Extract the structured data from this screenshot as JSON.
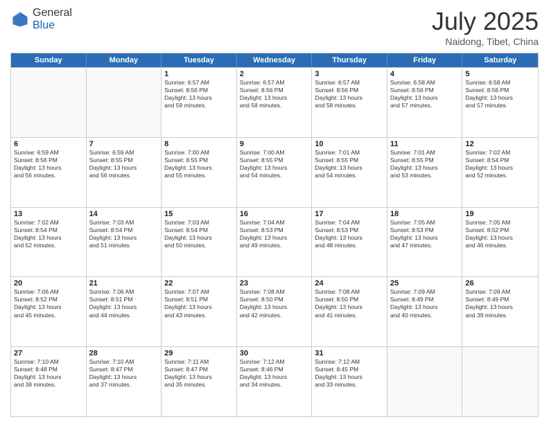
{
  "header": {
    "logo_general": "General",
    "logo_blue": "Blue",
    "month_title": "July 2025",
    "location": "Naidong, Tibet, China"
  },
  "weekdays": [
    "Sunday",
    "Monday",
    "Tuesday",
    "Wednesday",
    "Thursday",
    "Friday",
    "Saturday"
  ],
  "rows": [
    [
      {
        "day": "",
        "info": ""
      },
      {
        "day": "",
        "info": ""
      },
      {
        "day": "1",
        "info": "Sunrise: 6:57 AM\nSunset: 8:56 PM\nDaylight: 13 hours\nand 59 minutes."
      },
      {
        "day": "2",
        "info": "Sunrise: 6:57 AM\nSunset: 8:56 PM\nDaylight: 13 hours\nand 58 minutes."
      },
      {
        "day": "3",
        "info": "Sunrise: 6:57 AM\nSunset: 8:56 PM\nDaylight: 13 hours\nand 58 minutes."
      },
      {
        "day": "4",
        "info": "Sunrise: 6:58 AM\nSunset: 8:56 PM\nDaylight: 13 hours\nand 57 minutes."
      },
      {
        "day": "5",
        "info": "Sunrise: 6:58 AM\nSunset: 8:56 PM\nDaylight: 13 hours\nand 57 minutes."
      }
    ],
    [
      {
        "day": "6",
        "info": "Sunrise: 6:59 AM\nSunset: 8:56 PM\nDaylight: 13 hours\nand 56 minutes."
      },
      {
        "day": "7",
        "info": "Sunrise: 6:59 AM\nSunset: 8:55 PM\nDaylight: 13 hours\nand 56 minutes."
      },
      {
        "day": "8",
        "info": "Sunrise: 7:00 AM\nSunset: 8:55 PM\nDaylight: 13 hours\nand 55 minutes."
      },
      {
        "day": "9",
        "info": "Sunrise: 7:00 AM\nSunset: 8:55 PM\nDaylight: 13 hours\nand 54 minutes."
      },
      {
        "day": "10",
        "info": "Sunrise: 7:01 AM\nSunset: 8:55 PM\nDaylight: 13 hours\nand 54 minutes."
      },
      {
        "day": "11",
        "info": "Sunrise: 7:01 AM\nSunset: 8:55 PM\nDaylight: 13 hours\nand 53 minutes."
      },
      {
        "day": "12",
        "info": "Sunrise: 7:02 AM\nSunset: 8:54 PM\nDaylight: 13 hours\nand 52 minutes."
      }
    ],
    [
      {
        "day": "13",
        "info": "Sunrise: 7:02 AM\nSunset: 8:54 PM\nDaylight: 13 hours\nand 52 minutes."
      },
      {
        "day": "14",
        "info": "Sunrise: 7:03 AM\nSunset: 8:54 PM\nDaylight: 13 hours\nand 51 minutes."
      },
      {
        "day": "15",
        "info": "Sunrise: 7:03 AM\nSunset: 8:54 PM\nDaylight: 13 hours\nand 50 minutes."
      },
      {
        "day": "16",
        "info": "Sunrise: 7:04 AM\nSunset: 8:53 PM\nDaylight: 13 hours\nand 49 minutes."
      },
      {
        "day": "17",
        "info": "Sunrise: 7:04 AM\nSunset: 8:53 PM\nDaylight: 13 hours\nand 48 minutes."
      },
      {
        "day": "18",
        "info": "Sunrise: 7:05 AM\nSunset: 8:53 PM\nDaylight: 13 hours\nand 47 minutes."
      },
      {
        "day": "19",
        "info": "Sunrise: 7:05 AM\nSunset: 8:52 PM\nDaylight: 13 hours\nand 46 minutes."
      }
    ],
    [
      {
        "day": "20",
        "info": "Sunrise: 7:06 AM\nSunset: 8:52 PM\nDaylight: 13 hours\nand 45 minutes."
      },
      {
        "day": "21",
        "info": "Sunrise: 7:06 AM\nSunset: 8:51 PM\nDaylight: 13 hours\nand 44 minutes."
      },
      {
        "day": "22",
        "info": "Sunrise: 7:07 AM\nSunset: 8:51 PM\nDaylight: 13 hours\nand 43 minutes."
      },
      {
        "day": "23",
        "info": "Sunrise: 7:08 AM\nSunset: 8:50 PM\nDaylight: 13 hours\nand 42 minutes."
      },
      {
        "day": "24",
        "info": "Sunrise: 7:08 AM\nSunset: 8:50 PM\nDaylight: 13 hours\nand 41 minutes."
      },
      {
        "day": "25",
        "info": "Sunrise: 7:09 AM\nSunset: 8:49 PM\nDaylight: 13 hours\nand 40 minutes."
      },
      {
        "day": "26",
        "info": "Sunrise: 7:09 AM\nSunset: 8:49 PM\nDaylight: 13 hours\nand 39 minutes."
      }
    ],
    [
      {
        "day": "27",
        "info": "Sunrise: 7:10 AM\nSunset: 8:48 PM\nDaylight: 13 hours\nand 38 minutes."
      },
      {
        "day": "28",
        "info": "Sunrise: 7:10 AM\nSunset: 8:47 PM\nDaylight: 13 hours\nand 37 minutes."
      },
      {
        "day": "29",
        "info": "Sunrise: 7:11 AM\nSunset: 8:47 PM\nDaylight: 13 hours\nand 35 minutes."
      },
      {
        "day": "30",
        "info": "Sunrise: 7:12 AM\nSunset: 8:46 PM\nDaylight: 13 hours\nand 34 minutes."
      },
      {
        "day": "31",
        "info": "Sunrise: 7:12 AM\nSunset: 8:45 PM\nDaylight: 13 hours\nand 33 minutes."
      },
      {
        "day": "",
        "info": ""
      },
      {
        "day": "",
        "info": ""
      }
    ]
  ]
}
